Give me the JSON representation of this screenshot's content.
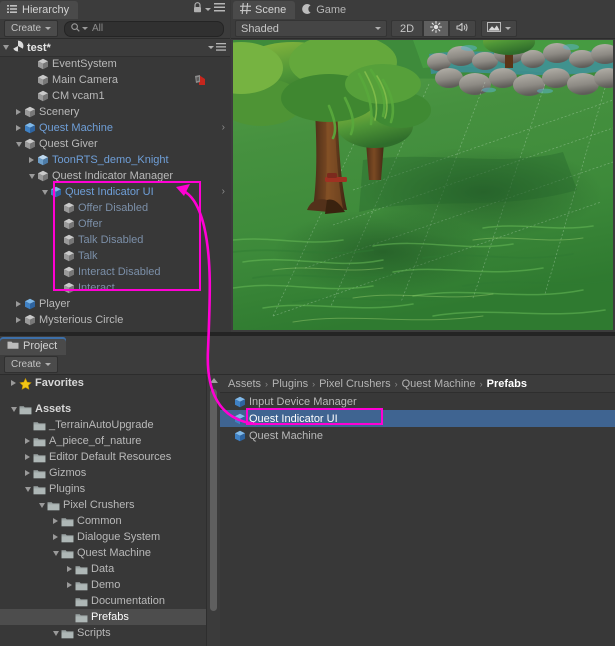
{
  "window": {
    "app": "Unity Editor",
    "accent_blue": "#3f6491",
    "annotation_color": "#ff00d4"
  },
  "hierarchy": {
    "tab_label": "Hierarchy",
    "tab_icon": "hierarchy-icon",
    "lock_icon": "lock-icon",
    "menu_icon": "hamburger-menu-icon",
    "create_label": "Create",
    "search_placeholder": "All",
    "search_icon": "search-icon",
    "scene_name": "test*",
    "items": [
      {
        "label": "EventSystem",
        "depth": 2,
        "arrow": "none",
        "style": "normal",
        "icon": "cube-gray",
        "chevron": false,
        "badge": null
      },
      {
        "label": "Main Camera",
        "depth": 2,
        "arrow": "none",
        "style": "normal",
        "icon": "cube-gray",
        "chevron": false,
        "badge": "cinemachine-brain-icon"
      },
      {
        "label": "CM vcam1",
        "depth": 2,
        "arrow": "none",
        "style": "normal",
        "icon": "cube-gray",
        "chevron": false,
        "badge": null
      },
      {
        "label": "Scenery",
        "depth": 1,
        "arrow": "right",
        "style": "normal",
        "icon": "cube-gray",
        "chevron": false,
        "badge": null
      },
      {
        "label": "Quest Machine",
        "depth": 1,
        "arrow": "right",
        "style": "prefab",
        "icon": "cube-blue",
        "chevron": true,
        "badge": null
      },
      {
        "label": "Quest Giver",
        "depth": 1,
        "arrow": "down",
        "style": "normal",
        "icon": "cube-gray",
        "chevron": false,
        "badge": null
      },
      {
        "label": "ToonRTS_demo_Knight",
        "depth": 2,
        "arrow": "right",
        "style": "prefab",
        "icon": "cube-model",
        "chevron": false,
        "badge": null
      },
      {
        "label": "Quest Indicator Manager",
        "depth": 2,
        "arrow": "down",
        "style": "normal",
        "icon": "cube-gray",
        "chevron": false,
        "badge": null
      },
      {
        "label": "Quest Indicator UI",
        "depth": 3,
        "arrow": "down",
        "style": "prefab",
        "icon": "cube-blue",
        "chevron": true,
        "badge": null
      },
      {
        "label": "Offer Disabled",
        "depth": 4,
        "arrow": "none",
        "style": "disabled",
        "icon": "cube-gray",
        "chevron": false,
        "badge": null
      },
      {
        "label": "Offer",
        "depth": 4,
        "arrow": "none",
        "style": "disabled",
        "icon": "cube-gray",
        "chevron": false,
        "badge": null
      },
      {
        "label": "Talk Disabled",
        "depth": 4,
        "arrow": "none",
        "style": "disabled",
        "icon": "cube-gray",
        "chevron": false,
        "badge": null
      },
      {
        "label": "Talk",
        "depth": 4,
        "arrow": "none",
        "style": "disabled",
        "icon": "cube-gray",
        "chevron": false,
        "badge": null
      },
      {
        "label": "Interact Disabled",
        "depth": 4,
        "arrow": "none",
        "style": "disabled",
        "icon": "cube-gray",
        "chevron": false,
        "badge": null
      },
      {
        "label": "Interact",
        "depth": 4,
        "arrow": "none",
        "style": "disabled",
        "icon": "cube-gray",
        "chevron": false,
        "badge": null
      },
      {
        "label": "Player",
        "depth": 1,
        "arrow": "right",
        "style": "normal",
        "icon": "cube-blue",
        "chevron": false,
        "badge": null
      },
      {
        "label": "Mysterious Circle",
        "depth": 1,
        "arrow": "right",
        "style": "normal",
        "icon": "cube-gray",
        "chevron": false,
        "badge": null
      }
    ]
  },
  "scene_panel": {
    "tabs": [
      {
        "label": "Scene",
        "icon": "grid-icon",
        "active": true
      },
      {
        "label": "Game",
        "icon": "gamepad-icon",
        "active": false
      }
    ],
    "toolbar": {
      "draw_mode": "Shaded",
      "mode_2d": "2D",
      "lighting_icon": "sun-icon",
      "audio_icon": "speaker-icon",
      "effects_icon": "image-effects-icon"
    }
  },
  "project_panel": {
    "tab_label": "Project",
    "tab_icon": "folder-icon",
    "create_label": "Create",
    "tree": [
      {
        "label": "Favorites",
        "depth": 0,
        "arrow": "right",
        "icon": "star",
        "bold": true,
        "selected": false
      },
      {
        "label": "",
        "depth": 0,
        "arrow": "none",
        "icon": "none",
        "bold": false,
        "selected": false
      },
      {
        "label": "Assets",
        "depth": 0,
        "arrow": "down",
        "icon": "folder",
        "bold": true,
        "selected": false
      },
      {
        "label": "_TerrainAutoUpgrade",
        "depth": 1,
        "arrow": "none",
        "icon": "folder",
        "bold": false,
        "selected": false
      },
      {
        "label": "A_piece_of_nature",
        "depth": 1,
        "arrow": "right",
        "icon": "folder",
        "bold": false,
        "selected": false
      },
      {
        "label": "Editor Default Resources",
        "depth": 1,
        "arrow": "right",
        "icon": "folder",
        "bold": false,
        "selected": false
      },
      {
        "label": "Gizmos",
        "depth": 1,
        "arrow": "right",
        "icon": "folder",
        "bold": false,
        "selected": false
      },
      {
        "label": "Plugins",
        "depth": 1,
        "arrow": "down",
        "icon": "folder",
        "bold": false,
        "selected": false
      },
      {
        "label": "Pixel Crushers",
        "depth": 2,
        "arrow": "down",
        "icon": "folder",
        "bold": false,
        "selected": false
      },
      {
        "label": "Common",
        "depth": 3,
        "arrow": "right",
        "icon": "folder",
        "bold": false,
        "selected": false
      },
      {
        "label": "Dialogue System",
        "depth": 3,
        "arrow": "right",
        "icon": "folder",
        "bold": false,
        "selected": false
      },
      {
        "label": "Quest Machine",
        "depth": 3,
        "arrow": "down",
        "icon": "folder",
        "bold": false,
        "selected": false
      },
      {
        "label": "Data",
        "depth": 4,
        "arrow": "right",
        "icon": "folder",
        "bold": false,
        "selected": false
      },
      {
        "label": "Demo",
        "depth": 4,
        "arrow": "right",
        "icon": "folder",
        "bold": false,
        "selected": false
      },
      {
        "label": "Documentation",
        "depth": 4,
        "arrow": "none",
        "icon": "folder",
        "bold": false,
        "selected": false
      },
      {
        "label": "Prefabs",
        "depth": 4,
        "arrow": "none",
        "icon": "folder",
        "bold": false,
        "selected": true
      },
      {
        "label": "Scripts",
        "depth": 3,
        "arrow": "down",
        "icon": "folder",
        "bold": false,
        "selected": false
      }
    ],
    "breadcrumb": [
      "Assets",
      "Plugins",
      "Pixel Crushers",
      "Quest Machine",
      "Prefabs"
    ],
    "breadcrumb_separator": "›",
    "assets": [
      {
        "label": "Input Device Manager",
        "icon": "prefab-cube-icon",
        "selected": false
      },
      {
        "label": "Quest Indicator UI",
        "icon": "prefab-cube-icon",
        "selected": true
      },
      {
        "label": "Quest Machine",
        "icon": "prefab-cube-icon",
        "selected": false
      }
    ]
  },
  "annotations": [
    {
      "name": "hierarchy-quest-indicator-highlight",
      "shape": "rect"
    },
    {
      "name": "project-quest-indicator-highlight",
      "shape": "rect"
    },
    {
      "name": "connector-arrow",
      "shape": "arrow"
    }
  ]
}
